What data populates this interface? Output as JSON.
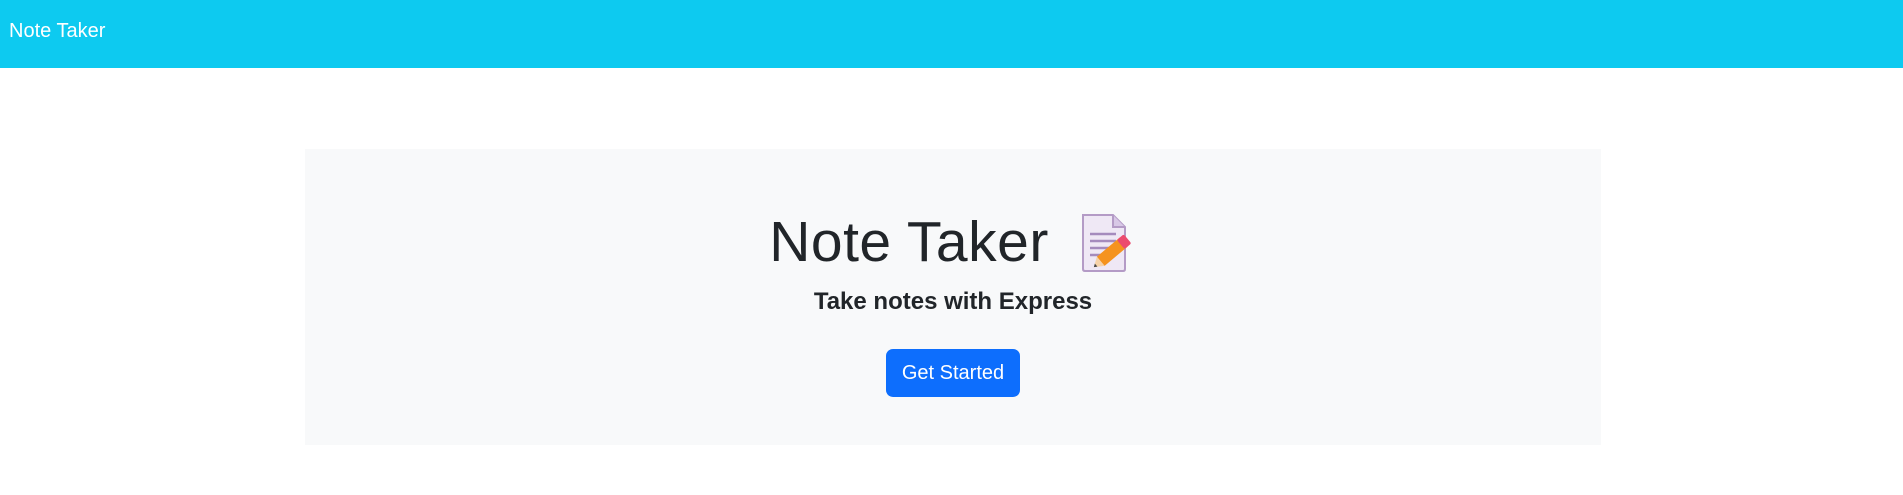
{
  "navbar": {
    "brand": "Note Taker",
    "bg_color": "#0dcaf0"
  },
  "hero": {
    "title": "Note Taker",
    "title_icon": "memo-icon",
    "subtitle": "Take notes with Express",
    "cta_label": "Get Started",
    "cta_color": "#0d6efd",
    "bg_color": "#f8f9fa"
  }
}
